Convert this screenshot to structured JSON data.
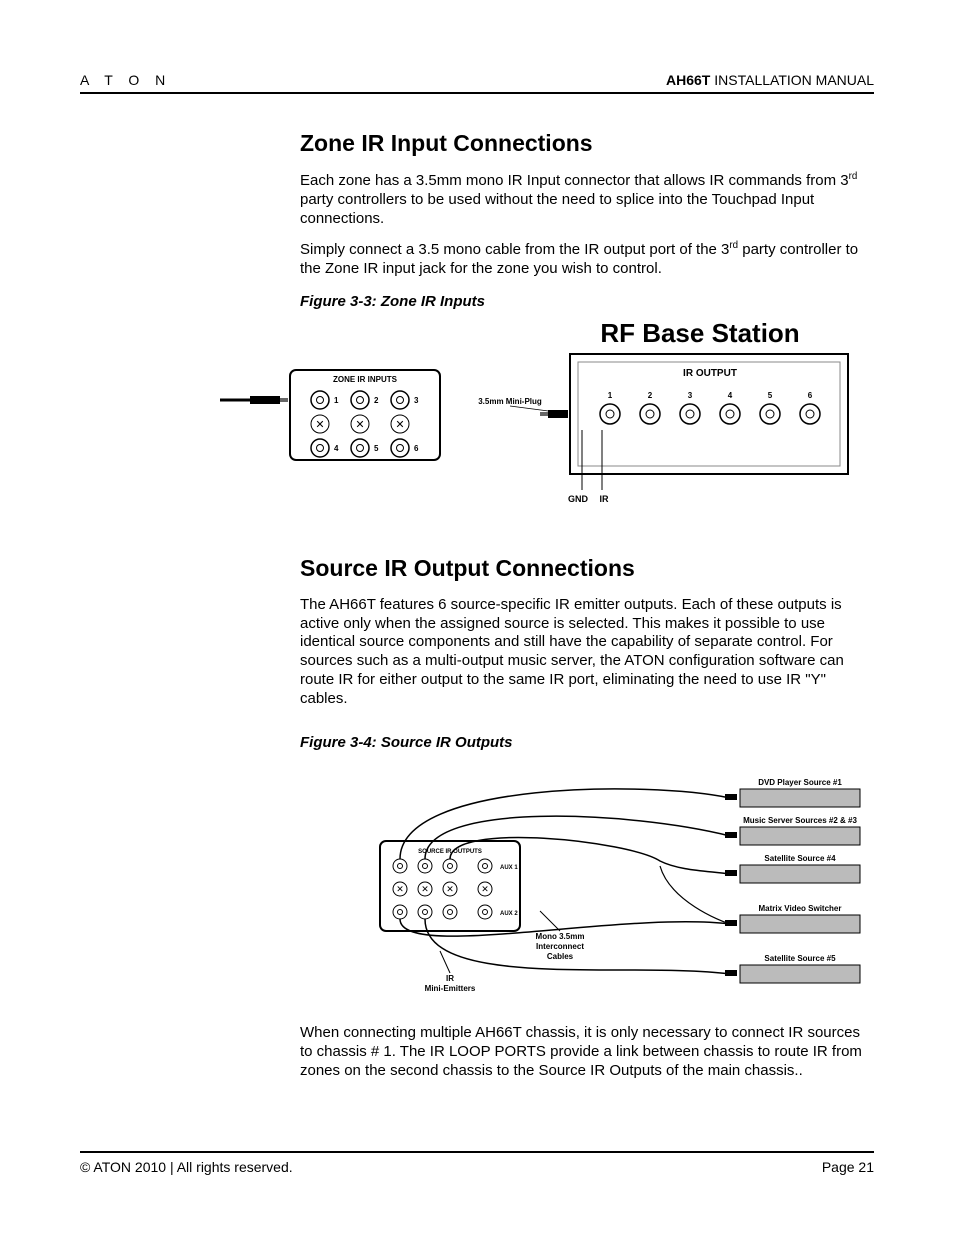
{
  "header": {
    "brand": "A T O N",
    "product": "AH66T",
    "title_suffix": " INSTALLATION MANUAL"
  },
  "section1": {
    "heading": "Zone IR Input Connections",
    "para1_a": "Each zone has a 3.5mm mono IR Input connector that allows IR commands from 3",
    "para1_sup": "rd",
    "para1_b": " party controllers to be used without the need to splice into the Touchpad Input connections.",
    "para2_a": "Simply connect a 3.5 mono cable from the IR output port of the 3",
    "para2_sup": "rd",
    "para2_b": " party controller to the Zone IR input jack for the zone you wish to control.",
    "fig_caption": "Figure 3-3: Zone IR Inputs",
    "fig": {
      "title": "RF Base Station",
      "panel_label": "ZONE IR INPUTS",
      "plug_label": "3.5mm Mini-Plug",
      "outputs_label": "IR OUTPUT",
      "gnd": "GND",
      "ir": "IR",
      "port_numbers": [
        "1",
        "2",
        "3",
        "4",
        "5",
        "6"
      ],
      "panel_ports": [
        "1",
        "2",
        "3",
        "4",
        "5",
        "6"
      ]
    }
  },
  "section2": {
    "heading": "Source IR Output Connections",
    "para1": "The AH66T features 6 source-specific IR emitter outputs.  Each of these outputs is active only when the assigned source is selected.  This makes it possible to use identical source components and still have the capability of separate control.  For sources such as a multi-output music server, the ATON configuration software can route IR for either output to the same IR port, eliminating the need to use IR \"Y\" cables.",
    "fig_caption": "Figure 3-4: Source IR Outputs",
    "fig": {
      "panel_top_label": "SOURCE IR OUTPUTS",
      "aux_labels": [
        "AUX 1",
        "AUX 2"
      ],
      "cable_label_line1": "Mono 3.5mm",
      "cable_label_line2": "Interconnect",
      "cable_label_line3": "Cables",
      "emitter_label_line1": "IR",
      "emitter_label_line2": "Mini-Emitters",
      "devices": [
        "DVD Player Source #1",
        "Music Server Sources #2 & #3",
        "Satellite Source #4",
        "Matrix Video Switcher",
        "Satellite Source #5"
      ]
    },
    "para2": "When connecting multiple AH66T chassis, it is only necessary to connect IR sources to chassis # 1.  The IR LOOP PORTS provide a link between chassis to route IR from zones on the second chassis to the Source IR Outputs of the main chassis.."
  },
  "footer": {
    "left": "© ATON 2010 | All rights reserved.",
    "right": "Page 21"
  }
}
